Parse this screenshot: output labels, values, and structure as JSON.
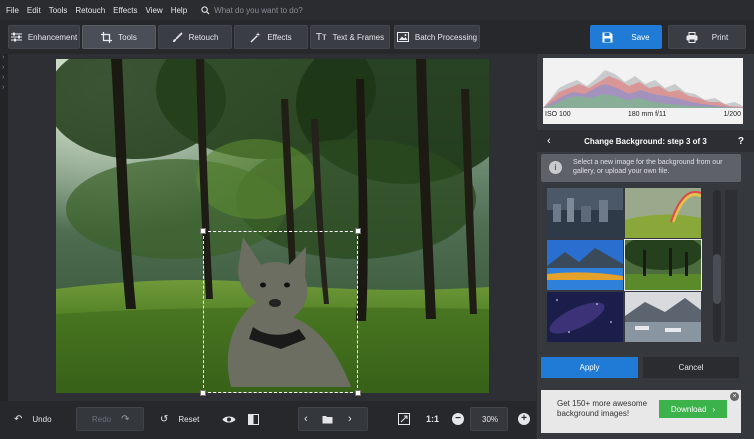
{
  "menu": {
    "items": [
      "File",
      "Edit",
      "Tools",
      "Retouch",
      "Effects",
      "View",
      "Help"
    ],
    "search_placeholder": "What do you want to do?"
  },
  "toolbar": {
    "tabs": [
      {
        "label": "Enhancement",
        "icon": "sliders-icon"
      },
      {
        "label": "Tools",
        "icon": "crop-icon",
        "active": true
      },
      {
        "label": "Retouch",
        "icon": "brush-icon"
      },
      {
        "label": "Effects",
        "icon": "magic-wand-icon"
      },
      {
        "label": "Text & Frames",
        "icon": "text-icon"
      },
      {
        "label": "Batch Processing",
        "icon": "images-icon"
      }
    ],
    "save_label": "Save",
    "print_label": "Print",
    "accent": "#1f7bd6"
  },
  "bottom": {
    "undo_label": "Undo",
    "redo_label": "Redo",
    "reset_label": "Reset",
    "ratio_label": "1:1",
    "zoom": "30%"
  },
  "histogram": {
    "iso": "ISO 100",
    "lens": "180 mm f/11",
    "shutter": "1/200"
  },
  "panel": {
    "step_title": "Change Background: step 3 of 3",
    "help": "?",
    "hint": "Select a new image for the background from our gallery, or upload your own file.",
    "gallery_selected_index": 3,
    "apply_label": "Apply",
    "cancel_label": "Cancel"
  },
  "promo": {
    "text": "Get 150+ more awesome background images!",
    "download_label": "Download",
    "download_color": "#3cb24b"
  }
}
